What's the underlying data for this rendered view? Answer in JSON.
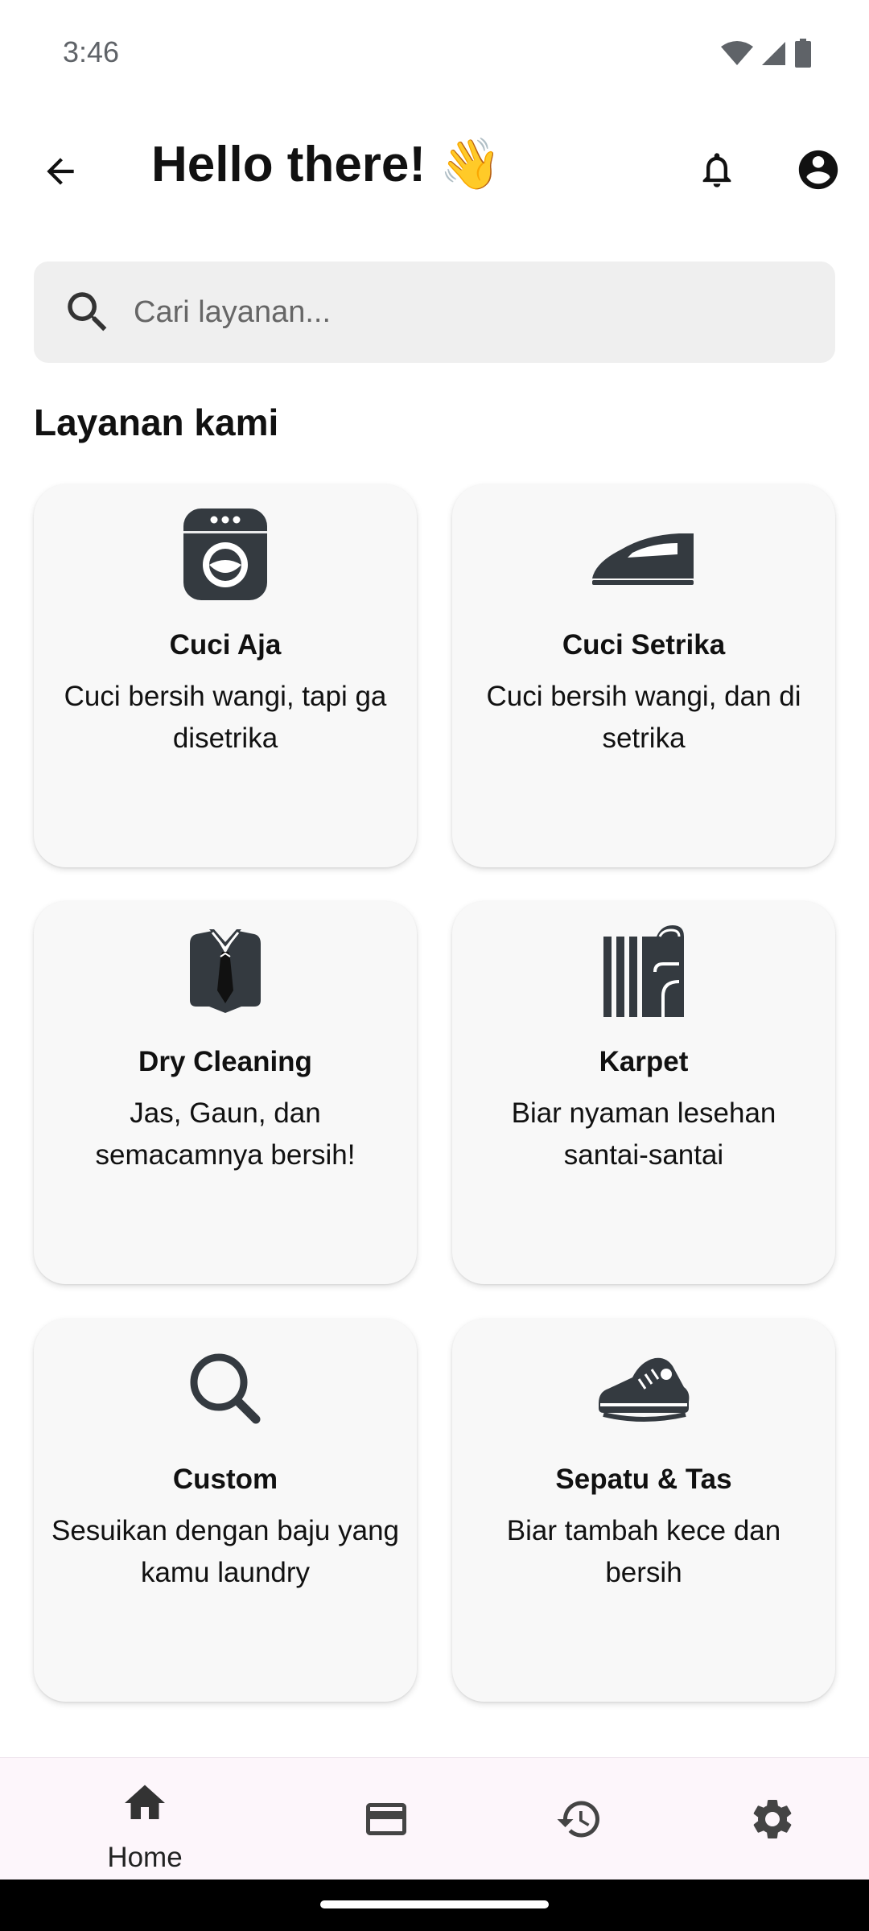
{
  "status_bar": {
    "time": "3:46"
  },
  "header": {
    "title": "Hello there! 👋"
  },
  "search": {
    "placeholder": "Cari layanan...",
    "value": ""
  },
  "section": {
    "title": "Layanan kami"
  },
  "services": [
    {
      "title": "Cuci Aja",
      "description": "Cuci bersih wangi, tapi ga disetrika",
      "icon": "washing-machine-icon"
    },
    {
      "title": "Cuci Setrika",
      "description": "Cuci bersih wangi, dan di setrika",
      "icon": "iron-icon"
    },
    {
      "title": "Dry Cleaning",
      "description": "Jas, Gaun, dan semacamnya bersih!",
      "icon": "suit-icon"
    },
    {
      "title": "Karpet",
      "description": "Biar nyaman lesehan santai-santai",
      "icon": "carpet-icon"
    },
    {
      "title": "Custom",
      "description": "Sesuikan dengan baju yang kamu laundry",
      "icon": "search-icon"
    },
    {
      "title": "Sepatu & Tas",
      "description": "Biar tambah kece dan bersih",
      "icon": "sneaker-icon"
    }
  ],
  "bottom_nav": {
    "items": [
      {
        "label": "Home",
        "icon": "home-icon",
        "active": true
      },
      {
        "label": "",
        "icon": "payment-card-icon",
        "active": false
      },
      {
        "label": "",
        "icon": "history-icon",
        "active": false
      },
      {
        "label": "",
        "icon": "settings-icon",
        "active": false
      }
    ]
  },
  "colors": {
    "icon_dark": "#343a40",
    "card_bg": "#f8f8f8",
    "nav_bg": "#fdf6fb",
    "search_bg": "#efefef"
  }
}
